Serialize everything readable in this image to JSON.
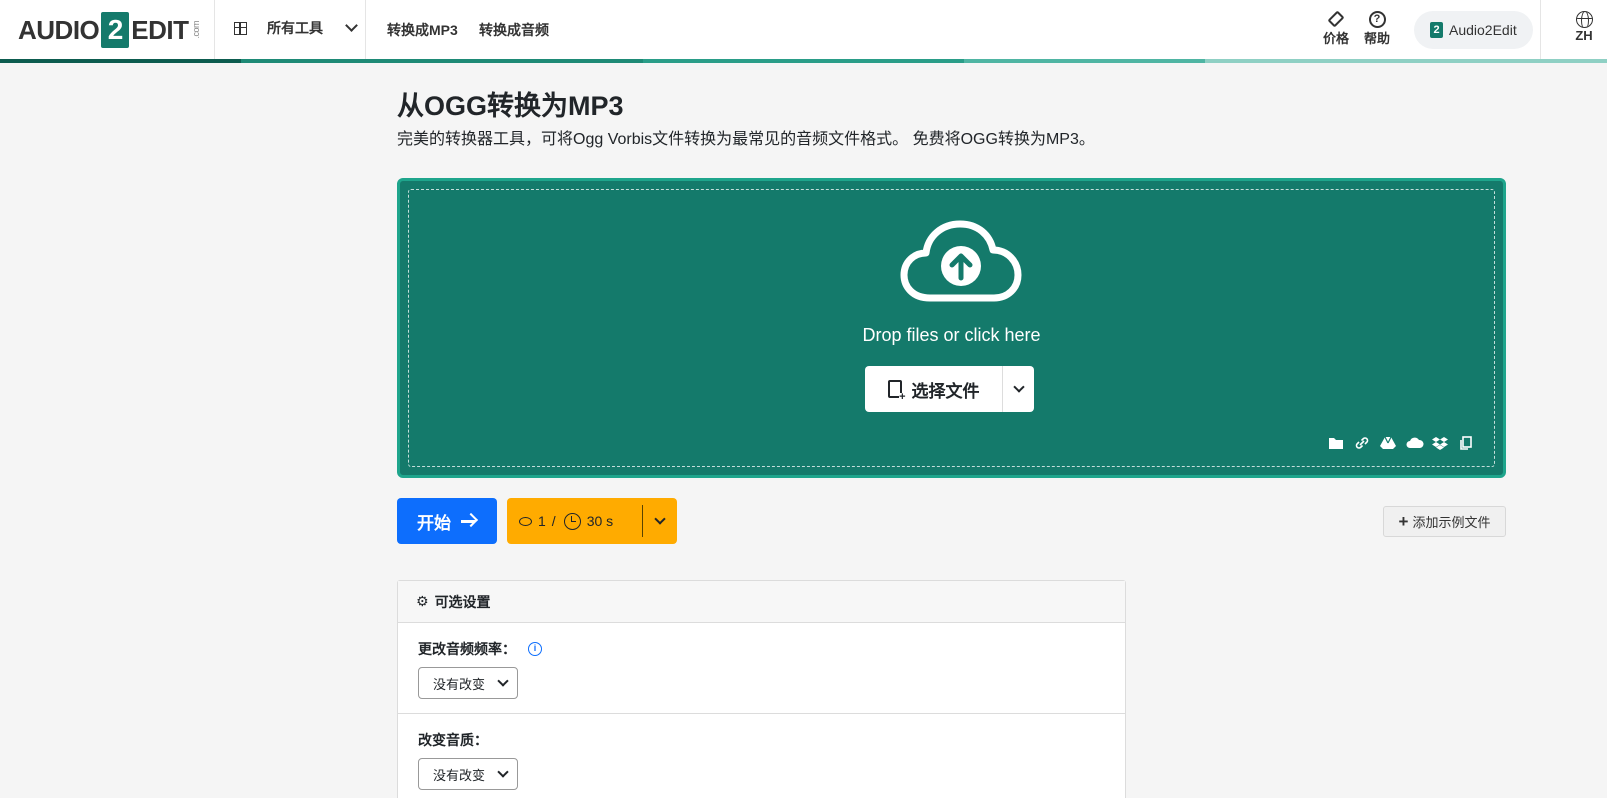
{
  "header": {
    "logo": {
      "pre": "AUDIO",
      "num": "2",
      "post": "EDIT",
      "suffix": ".com"
    },
    "tools_label": "所有工具",
    "nav": [
      "转换成MP3",
      "转换成音频"
    ],
    "pricing_label": "价格",
    "help_label": "帮助",
    "account_label": "Audio2Edit",
    "lang_label": "ZH"
  },
  "main": {
    "title": "从OGG转换为MP3",
    "subtitle": "完美的转换器工具，可将Ogg Vorbis文件转换为最常见的音频文件格式。 免费将OGG转换为MP3。"
  },
  "dropzone": {
    "drop_text": "Drop files or click here",
    "choose_label": "选择文件",
    "source_icons": [
      "folder-icon",
      "link-icon",
      "google-drive-icon",
      "onedrive-icon",
      "dropbox-icon",
      "clipboard-icon"
    ]
  },
  "actions": {
    "start_label": "开始",
    "credits": "1",
    "credit_sep": "/",
    "time": "30 s",
    "sample_label": "添加示例文件"
  },
  "settings": {
    "title": "可选设置",
    "rows": [
      {
        "label": "更改音频频率：",
        "value": "没有改变"
      },
      {
        "label": "改变音质：",
        "value": "没有改变"
      }
    ]
  },
  "colors": {
    "brand": "#147a6b",
    "dropzone_border": "#1ea58c",
    "primary": "#0d6efd",
    "warning": "#ffab00"
  }
}
